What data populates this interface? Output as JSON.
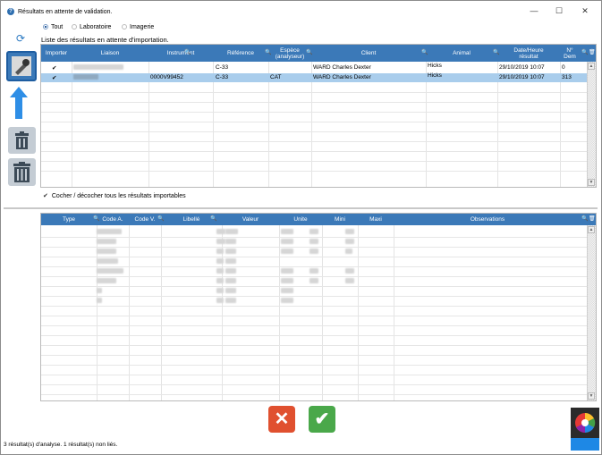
{
  "window": {
    "title": "Résultats en attente de validation.",
    "minimize": "—",
    "maximize": "☐",
    "close": "✕"
  },
  "filters": [
    {
      "label": "Tout",
      "selected": true
    },
    {
      "label": "Laboratoire",
      "selected": false
    },
    {
      "label": "Imagerie",
      "selected": false
    }
  ],
  "list_title": "Liste des résultats en attente d'importation.",
  "top_grid": {
    "headers": [
      "Importer",
      "Liaison",
      "Instrument",
      "Référence",
      "Espèce\n(analyseur)",
      "Client",
      "Animal",
      "Date/Heure\nrésultat",
      "N°\nDem"
    ],
    "rows": [
      {
        "importer": "✔",
        "instrument": "",
        "reference": "C-33",
        "espece": "",
        "client": "WARD Charles Dexter",
        "animal": "Hicks",
        "date": "29/10/2019 10:07",
        "num": "0",
        "selected": false
      },
      {
        "importer": "✔",
        "instrument": "0000V99452",
        "reference": "C-33",
        "espece": "CAT",
        "client": "WARD Charles Dexter",
        "animal": "Hicks",
        "date": "29/10/2019 10:07",
        "num": "313",
        "selected": true
      }
    ]
  },
  "toggle_all_label": "Cocher / décocher tous les résultats importables",
  "bottom_grid": {
    "headers": [
      "Type",
      "Code A.",
      "Code V.",
      "Libellé",
      "Valeur",
      "Unite",
      "Mini",
      "Maxi",
      "Observations"
    ]
  },
  "status_text": "3 résultat(s) d'analyse. 1 résultat(s) non liés.",
  "colors": {
    "header_blue": "#3b79b8",
    "selected_row": "#a9cdec",
    "cancel_red": "#e0502f",
    "ok_green": "#4aa84a"
  },
  "icons": [
    "refresh-icon",
    "import-icon",
    "arrow-up-icon",
    "trash-icon",
    "trash-all-icon",
    "cancel-icon",
    "validate-icon",
    "color-wheel-icon"
  ]
}
